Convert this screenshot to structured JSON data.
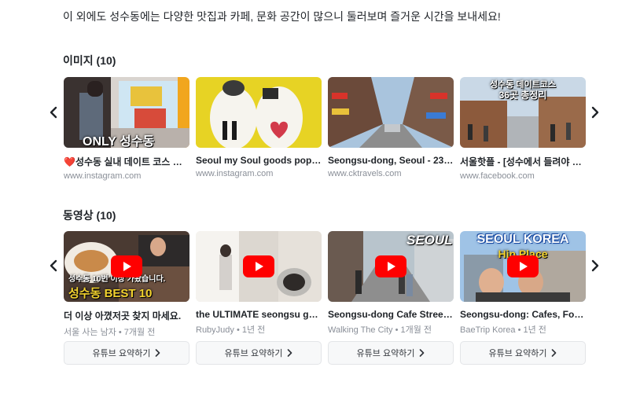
{
  "intro": "이 외에도 성수동에는 다양한 맛집과 카페, 문화 공간이 많으니 둘러보며 즐거운 시간을 보내세요!",
  "images": {
    "title": "이미지 (10)",
    "cards": [
      {
        "title": "❤️성수동 실내 데이트 코스 추천...",
        "source": "www.instagram.com",
        "overlay": "ONLY 성수동",
        "icon": "toy-story-photo"
      },
      {
        "title": "Seoul my Soul goods pop-u...",
        "source": "www.instagram.com",
        "overlay": "",
        "icon": "slippers-photo"
      },
      {
        "title": "Seongsu-dong, Seoul - 23 ...",
        "source": "www.cktravels.com",
        "overlay": "",
        "icon": "street-photo"
      },
      {
        "title": "서울핫플 - [성수에서 들려야 할 ...",
        "source": "www.facebook.com",
        "overlay1": "성수동 데이트코스",
        "overlay2": "36곳 총정리",
        "icon": "street-photo-2"
      }
    ]
  },
  "videos": {
    "title": "동영상 (10)",
    "cards": [
      {
        "title": "더 이상 아꼈저곳 찾지 마세요.",
        "source": "서울 사는 남자 • 7개월 전",
        "overlay1": "성수동 10번 이상 가봤습니다.",
        "overlay2": "성수동 BEST 10",
        "button": "유튜브 요약하기"
      },
      {
        "title": "the ULTIMATE seongsu gui...",
        "source": "RubyJudy • 1년 전",
        "overlay1": "",
        "button": "유튜브 요약하기"
      },
      {
        "title": "Seongsu-dong Cafe Street ...",
        "source": "Walking The City • 1개월 전",
        "overlay1": "SEOUL",
        "button": "유튜브 요약하기"
      },
      {
        "title": "Seongsu-dong: Cafes, Foo...",
        "source": "BaeTrip Korea • 1년 전",
        "overlay1": "SEOUL KOREA",
        "overlay2": "Hip Place",
        "button": "유튜브 요약하기"
      }
    ]
  },
  "nav": {
    "prev": "‹",
    "next": "›"
  },
  "colors": {
    "youtube_red": "#ff0000",
    "accent_heart": "#e0262e"
  }
}
